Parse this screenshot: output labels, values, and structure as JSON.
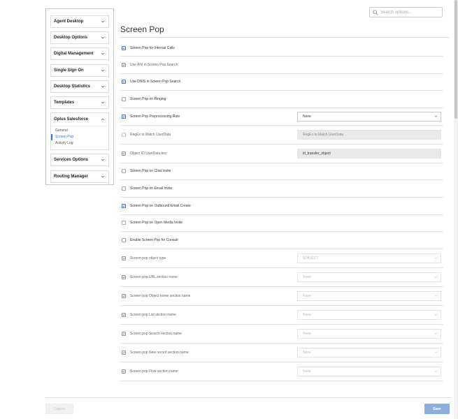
{
  "search": {
    "placeholder": "Search options..."
  },
  "sidebar": {
    "items": [
      {
        "label": "Agent Desktop"
      },
      {
        "label": "Desktop Options"
      },
      {
        "label": "Digital Management"
      },
      {
        "label": "Single Sign On"
      },
      {
        "label": "Desktop Statistics"
      },
      {
        "label": "Templates"
      },
      {
        "label": "Gplus Salesforce",
        "expanded": true,
        "children": [
          {
            "label": "General"
          },
          {
            "label": "Screen Pop",
            "active": true
          },
          {
            "label": "Activity Log"
          }
        ]
      },
      {
        "label": "Services Options"
      },
      {
        "label": "Routing Manager"
      }
    ]
  },
  "main": {
    "title": "Screen Pop",
    "rows": [
      {
        "label": "Screen Pop for Internal Calls",
        "checked": true,
        "enabled": true
      },
      {
        "label": "Use ANI in Screen Pop Search",
        "checked": true,
        "enabled": false
      },
      {
        "label": "Use DNIS in Screen Pop Search",
        "checked": true,
        "enabled": true
      },
      {
        "label": "Screen Pop on Ringing",
        "checked": false,
        "enabled": true
      },
      {
        "label": "Screen Pop Preprocessing Rule",
        "checked": true,
        "enabled": true,
        "select": "None"
      },
      {
        "label": "RegEx to Match UserData",
        "checked": false,
        "enabled": false,
        "text": "RegEx to Match UserData",
        "text_dim": true
      },
      {
        "label": "Object ID UserData key",
        "checked": true,
        "enabled": false,
        "text": "id_transfer_object"
      },
      {
        "label": "Screen Pop on Chat Invite",
        "checked": false,
        "enabled": true
      },
      {
        "label": "Screen Pop on Email Invite",
        "checked": false,
        "enabled": true
      },
      {
        "label": "Screen Pop on Outbound Email Create",
        "checked": true,
        "enabled": true
      },
      {
        "label": "Screen Pop on Open Media Invite",
        "checked": false,
        "enabled": true
      },
      {
        "label": "Enable Screen Pop for Consult",
        "checked": false,
        "enabled": true
      },
      {
        "label": "Screen pop object type",
        "checked": true,
        "enabled": false,
        "select": "$OBJECT",
        "disabled": true
      },
      {
        "label": "Screen pop URL section name",
        "checked": true,
        "enabled": false,
        "select": "None",
        "disabled": true
      },
      {
        "label": "Screen pop Object home section name",
        "checked": true,
        "enabled": false,
        "select": "None",
        "disabled": true
      },
      {
        "label": "Screen pop List section name",
        "checked": true,
        "enabled": false,
        "select": "None",
        "disabled": true
      },
      {
        "label": "Screen pop Search section name",
        "checked": true,
        "enabled": false,
        "select": "None",
        "disabled": true
      },
      {
        "label": "Screen pop New record section name",
        "checked": true,
        "enabled": false,
        "select": "None",
        "disabled": true
      },
      {
        "label": "Screen pop Flow section name",
        "checked": true,
        "enabled": false,
        "select": "None",
        "disabled": true
      }
    ]
  },
  "footer": {
    "cancel_label": "Cancel",
    "save_label": "Save"
  },
  "colors": {
    "accent": "#2f7bd6",
    "save_bg": "#8eaedb",
    "checkbox_checked": "#4a77c6"
  },
  "icons": {
    "search": "search-icon",
    "chevron": "chevron-down-icon",
    "chevron_up": "chevron-up-icon",
    "check": "checkmark-icon"
  }
}
